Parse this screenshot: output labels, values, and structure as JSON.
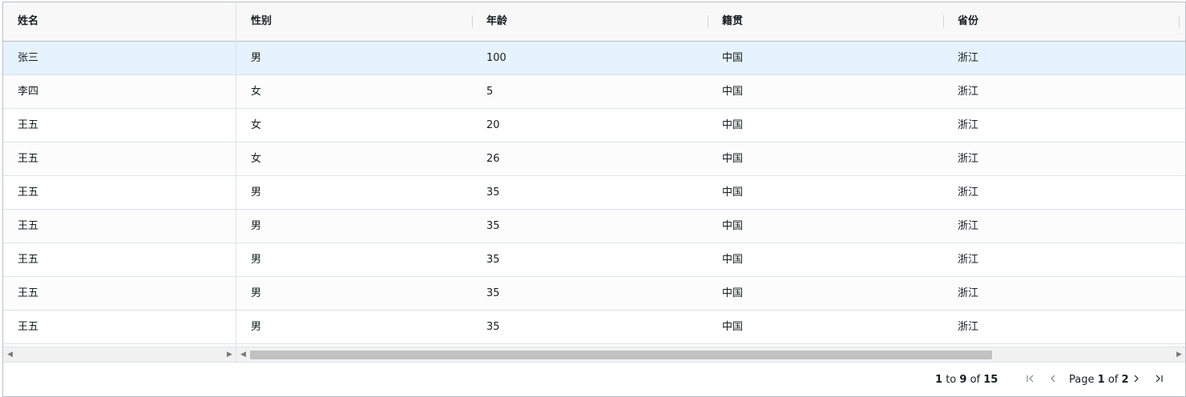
{
  "columns": [
    "姓名",
    "性别",
    "年龄",
    "籍贯",
    "省份"
  ],
  "rows": [
    {
      "name": "张三",
      "gender": "男",
      "age": "100",
      "origin": "中国",
      "province": "浙江"
    },
    {
      "name": "李四",
      "gender": "女",
      "age": "5",
      "origin": "中国",
      "province": "浙江"
    },
    {
      "name": "王五",
      "gender": "女",
      "age": "20",
      "origin": "中国",
      "province": "浙江"
    },
    {
      "name": "王五",
      "gender": "女",
      "age": "26",
      "origin": "中国",
      "province": "浙江"
    },
    {
      "name": "王五",
      "gender": "男",
      "age": "35",
      "origin": "中国",
      "province": "浙江"
    },
    {
      "name": "王五",
      "gender": "男",
      "age": "35",
      "origin": "中国",
      "province": "浙江"
    },
    {
      "name": "王五",
      "gender": "男",
      "age": "35",
      "origin": "中国",
      "province": "浙江"
    },
    {
      "name": "王五",
      "gender": "男",
      "age": "35",
      "origin": "中国",
      "province": "浙江"
    },
    {
      "name": "王五",
      "gender": "男",
      "age": "35",
      "origin": "中国",
      "province": "浙江"
    }
  ],
  "selected_row": 0,
  "pagination": {
    "row_start": "1",
    "to_label": "to",
    "row_end": "9",
    "of_label": "of",
    "row_total": "15",
    "page_label": "Page",
    "current_page": "1",
    "page_of_label": "of",
    "total_pages": "2"
  },
  "icons": {
    "first_page": "first-page-icon",
    "prev_page": "previous-page-icon",
    "next_page": "next-page-icon",
    "last_page": "last-page-icon"
  },
  "colors": {
    "selected_row": "#e6f2fd",
    "header_bg": "#f8f8f8",
    "border": "#babfc7"
  }
}
